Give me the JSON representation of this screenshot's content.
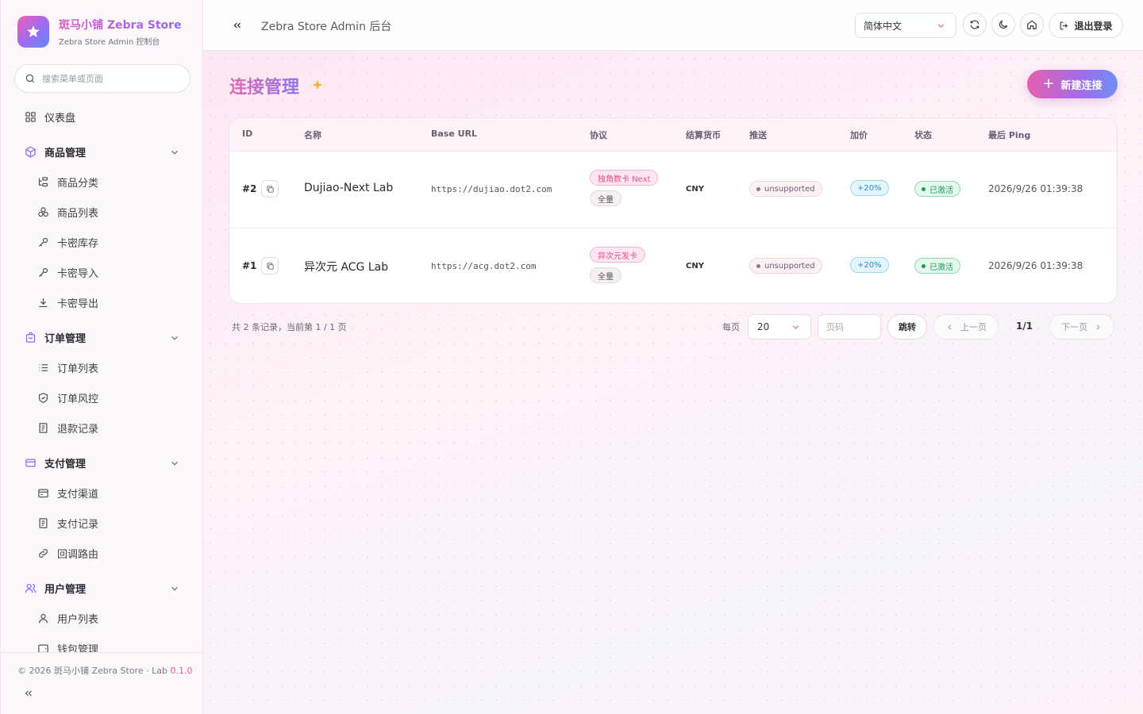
{
  "brand": {
    "title": "斑马小铺 Zebra Store",
    "subtitle": "Zebra Store Admin 控制台"
  },
  "sidebar": {
    "search_placeholder": "搜索菜单或页面",
    "dashboard": "仪表盘",
    "groups": [
      {
        "label": "商品管理",
        "items": [
          "商品分类",
          "商品列表",
          "卡密库存",
          "卡密导入",
          "卡密导出"
        ]
      },
      {
        "label": "订单管理",
        "items": [
          "订单列表",
          "订单风控",
          "退款记录"
        ]
      },
      {
        "label": "支付管理",
        "items": [
          "支付渠道",
          "支付记录",
          "回调路由"
        ]
      },
      {
        "label": "用户管理",
        "items": [
          "用户列表",
          "钱包管理"
        ]
      }
    ],
    "footer_copy": "© 2026 斑马小铺 Zebra Store · Lab",
    "footer_version": "0.1.0"
  },
  "header": {
    "title": "Zebra Store Admin 后台",
    "language": "简体中文",
    "logout_label": "退出登录"
  },
  "page": {
    "title": "连接管理",
    "new_button": "新建连接"
  },
  "table": {
    "columns": [
      "ID",
      "名称",
      "Base URL",
      "协议",
      "结算货币",
      "推送",
      "加价",
      "状态",
      "最后 Ping"
    ],
    "rows": [
      {
        "id": "#2",
        "name": "Dujiao-Next Lab",
        "base_url": "https://dujiao.dot2.com",
        "protocol": "独角数卡 Next",
        "scope": "全量",
        "currency": "CNY",
        "push": "unsupported",
        "markup": "+20%",
        "status": "已激活",
        "last_ping": "2026/9/26 01:39:38"
      },
      {
        "id": "#1",
        "name": "异次元 ACG Lab",
        "base_url": "https://acg.dot2.com",
        "protocol": "异次元发卡",
        "scope": "全量",
        "currency": "CNY",
        "push": "unsupported",
        "markup": "+20%",
        "status": "已激活",
        "last_ping": "2026/9/26 01:39:38"
      }
    ]
  },
  "pagination": {
    "summary": "共 2 条记录，当前第 1 / 1 页",
    "per_page_label": "每页",
    "page_size": "20",
    "page_input_placeholder": "页码",
    "jump_label": "跳转",
    "prev_label": "上一页",
    "current": "1/1",
    "next_label": "下一页"
  },
  "colors": {
    "accent_pink": "#e45fae",
    "accent_purple": "#a06de8",
    "accent_blue": "#6f8df4",
    "status_green": "#1f9a5a",
    "markup_blue": "#2f8cc4"
  },
  "icons": {
    "brand": "star-icon",
    "search": "search-icon",
    "refresh": "refresh-icon",
    "theme": "moon-icon",
    "home": "home-icon",
    "logout": "logout-icon"
  }
}
